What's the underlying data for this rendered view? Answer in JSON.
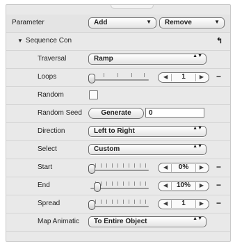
{
  "header": {
    "label": "Parameter",
    "add_label": "Add",
    "remove_label": "Remove"
  },
  "group": {
    "title": "Sequence Con",
    "reset_icon": "reset-icon"
  },
  "rows": {
    "traversal": {
      "label": "Traversal",
      "value": "Ramp"
    },
    "loops": {
      "label": "Loops",
      "value": "1",
      "slider_level": 0
    },
    "random": {
      "label": "Random",
      "checked": false
    },
    "random_seed": {
      "label": "Random Seed",
      "button_label": "Generate",
      "value": "0"
    },
    "direction": {
      "label": "Direction",
      "value": "Left to Right"
    },
    "select": {
      "label": "Select",
      "value": "Custom"
    },
    "start": {
      "label": "Start",
      "value": "0%",
      "slider_level": 0
    },
    "end": {
      "label": "End",
      "value": "10%",
      "slider_level": 0.1
    },
    "spread": {
      "label": "Spread",
      "value": "1",
      "slider_level": 0
    },
    "map_animation": {
      "label": "Map Animatic",
      "value": "To Entire Object"
    }
  },
  "icons": {
    "stepper_left": "◀",
    "stepper_right": "▶",
    "popup_down": "▼",
    "popup_updown": "▲▼",
    "minus": "−",
    "disclosure": "▼",
    "reset": "↰"
  }
}
